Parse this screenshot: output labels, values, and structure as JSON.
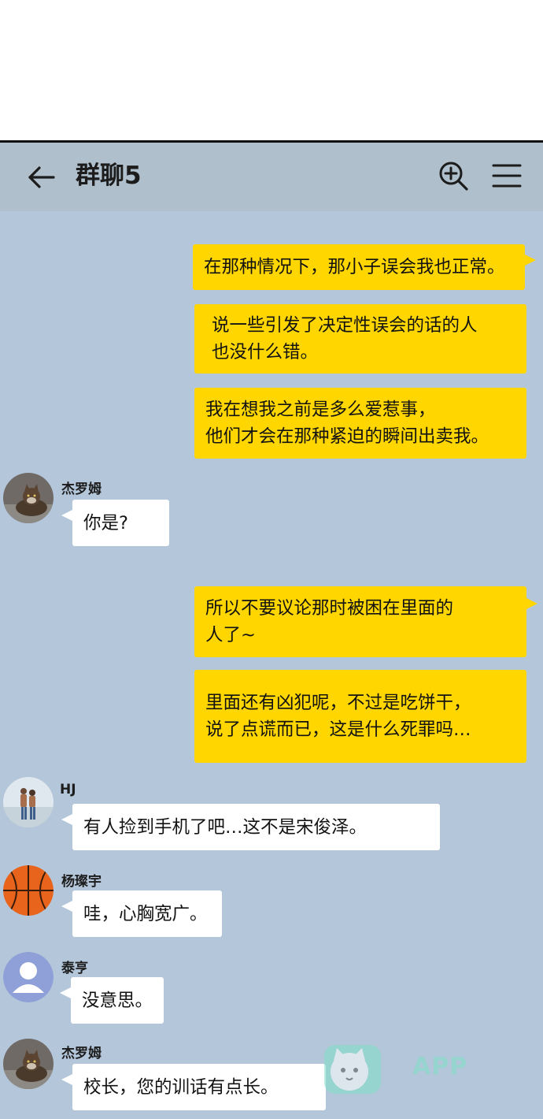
{
  "header": {
    "title": "群聊5",
    "back_icon": "arrow-left-icon",
    "search_icon": "zoom-in-icon",
    "menu_icon": "hamburger-menu-icon"
  },
  "colors": {
    "header_bg": "#afbfcc",
    "chat_bg": "#b4c6d9",
    "my_bubble": "#ffd600",
    "other_bubble": "#ffffff"
  },
  "messages": [
    {
      "from": "me",
      "lines": [
        "在那种情况下，那小子误会我也正常。"
      ]
    },
    {
      "from": "me",
      "lines": [
        "说一些引发了决定性误会的话的人",
        "也没什么错。"
      ]
    },
    {
      "from": "me",
      "lines": [
        "我在想我之前是多么爱惹事，",
        "他们才会在那种紧迫的瞬间出卖我。"
      ]
    },
    {
      "from": "other",
      "sender": "杰罗姆",
      "avatar": "cat-avatar",
      "lines": [
        "你是?"
      ]
    },
    {
      "from": "me",
      "lines": [
        "所以不要议论那时被困在里面的",
        "人了~"
      ]
    },
    {
      "from": "me",
      "lines": [
        "里面还有凶犯呢，不过是吃饼干，",
        "说了点谎而已，这是什么死罪吗…"
      ]
    },
    {
      "from": "other",
      "sender": "HJ",
      "avatar": "couple-photo-avatar",
      "lines": [
        "有人捡到手机了吧…这不是宋俊泽。"
      ]
    },
    {
      "from": "other",
      "sender": "杨璨宇",
      "avatar": "basketball-avatar",
      "lines": [
        "哇，心胸宽广。"
      ]
    },
    {
      "from": "other",
      "sender": "泰亨",
      "avatar": "default-user-avatar",
      "lines": [
        "没意思。"
      ]
    },
    {
      "from": "other",
      "sender": "杰罗姆",
      "avatar": "cat-avatar",
      "lines": [
        "校长，您的训话有点长。"
      ]
    }
  ],
  "watermark": {
    "icon": "cat-mascot-icon",
    "text": "  APP"
  }
}
